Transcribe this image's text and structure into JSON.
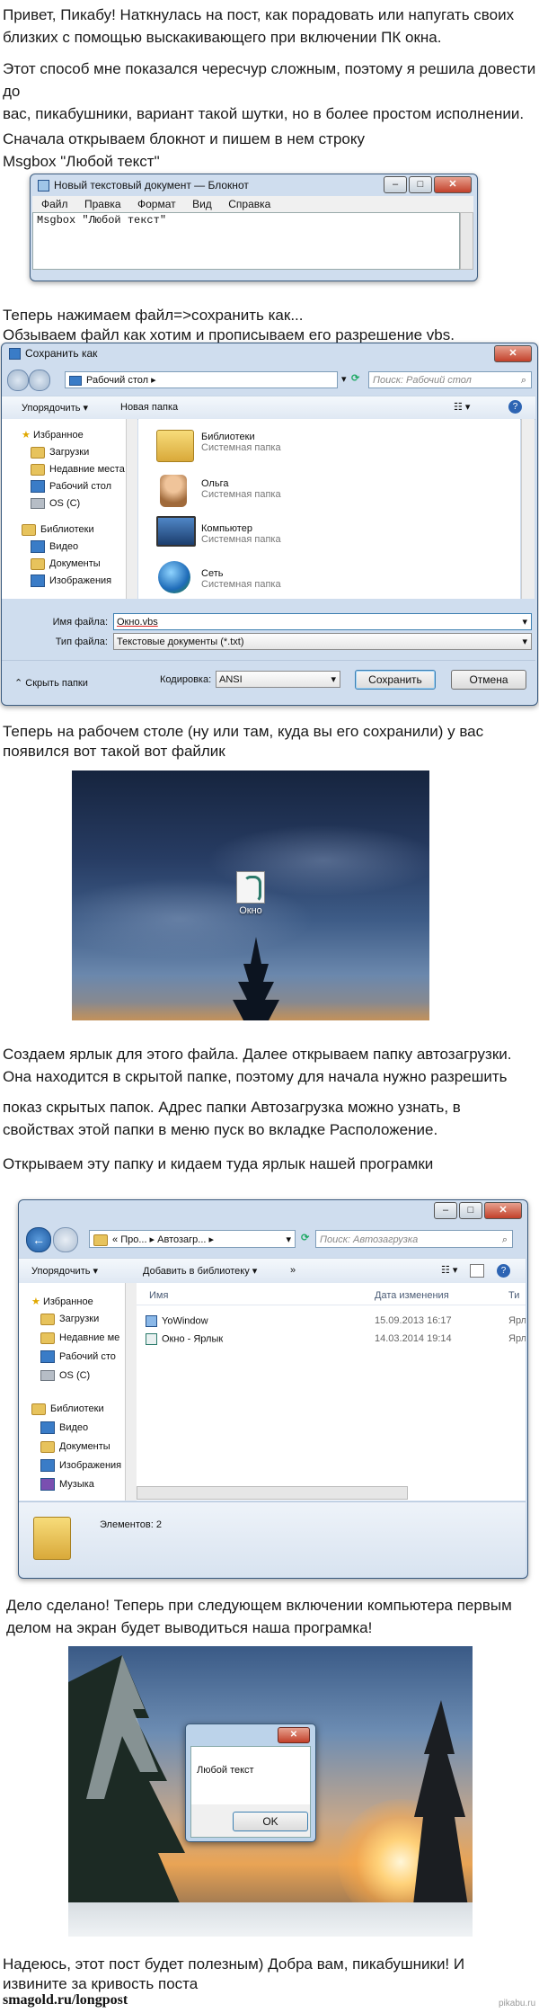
{
  "intro": {
    "line1": "Привет, Пикабу! Наткнулась на пост, как порадовать или напугать своих",
    "line2": "близких с помощью выскакивающего при включении ПК окна.",
    "line3": "Этот способ мне показался чересчур сложным, поэтому я решила довести до",
    "line4": "вас, пикабушники, вариант такой шутки, но в более простом исполнении."
  },
  "step1": {
    "line1": "Сначала открываем блокнот и пишем в нем строку",
    "line2": "Msgbox \"Любой текст\""
  },
  "notepad": {
    "title": "Новый текстовый документ — Блокнот",
    "menu": [
      "Файл",
      "Правка",
      "Формат",
      "Вид",
      "Справка"
    ],
    "content": "Msgbox \"Любой текст\""
  },
  "step2": {
    "line1": "Теперь нажимаем файл=>сохранить как...",
    "line2": "Обзываем файл как хотим и прописываем его разрешение vbs."
  },
  "save_dialog": {
    "title": "Сохранить как",
    "location": "Рабочий стол",
    "search_placeholder": "Поиск: Рабочий стол",
    "organize": "Упорядочить ▾",
    "new_folder": "Новая папка",
    "sidebar": [
      "Избранное",
      "Загрузки",
      "Недавние места",
      "Рабочий стол",
      "OS (C)",
      "Библиотеки",
      "Видео",
      "Документы",
      "Изображения"
    ],
    "items": [
      {
        "name": "Библиотеки",
        "sub": "Системная папка"
      },
      {
        "name": "Ольга",
        "sub": "Системная папка"
      },
      {
        "name": "Компьютер",
        "sub": "Системная папка"
      },
      {
        "name": "Сеть",
        "sub": "Системная папка"
      }
    ],
    "filename_label": "Имя файла:",
    "filename_value": "Окно.vbs",
    "filetype_label": "Тип файла:",
    "filetype_value": "Текстовые документы (*.txt)",
    "hide_folders": "Скрыть папки",
    "encoding_label": "Кодировка:",
    "encoding_value": "ANSI",
    "save_btn": "Сохранить",
    "cancel_btn": "Отмена"
  },
  "step3": {
    "line1": "Теперь на рабочем столе (ну или там, куда вы его сохранили) у вас",
    "line2": "появился вот такой вот файлик"
  },
  "desktop_icon": {
    "label": "Окно"
  },
  "step4": {
    "line1": "Создаем ярлык для этого файла. Далее открываем папку автозагрузки.",
    "line2": "Она находится в скрытой папке, поэтому для начала нужно разрешить",
    "line3": "показ скрытых папок. Адрес папки Автозагрузка можно узнать, в",
    "line4": "свойствах этой папки в меню пуск во вкладке Расположение.",
    "line5": "Открываем эту папку и кидаем туда ярлык нашей програмки"
  },
  "explorer": {
    "path1": "Про...",
    "path2": "Автозагр...",
    "search_placeholder": "Поиск: Автозагрузка",
    "organize": "Упорядочить ▾",
    "add_library": "Добавить в библиотеку ▾",
    "more": "»",
    "sidebar": [
      "Избранное",
      "Загрузки",
      "Недавние ме",
      "Рабочий сто",
      "OS (C)",
      "Библиотеки",
      "Видео",
      "Документы",
      "Изображения",
      "Музыка"
    ],
    "col_name": "Имя",
    "col_date": "Дата изменения",
    "col_type": "Ти",
    "files": [
      {
        "name": "YoWindow",
        "date": "15.09.2013 16:17",
        "type": "Ярл"
      },
      {
        "name": "Окно - Ярлык",
        "date": "14.03.2014 19:14",
        "type": "Ярл"
      }
    ],
    "status": "Элементов: 2"
  },
  "step5": {
    "line1": "Дело сделано! Теперь при следующем включении компьютера первым",
    "line2": "делом на экран будет выводиться наша програмка!"
  },
  "msgbox": {
    "text": "Любой текст",
    "ok": "OK"
  },
  "outro": {
    "line1": "Надеюсь, этот пост будет полезным) Добра вам, пикабушники! И",
    "line2": "извините за кривость поста"
  },
  "footer": {
    "left": "smagold.ru/longpost",
    "right": "pikabu.ru"
  }
}
